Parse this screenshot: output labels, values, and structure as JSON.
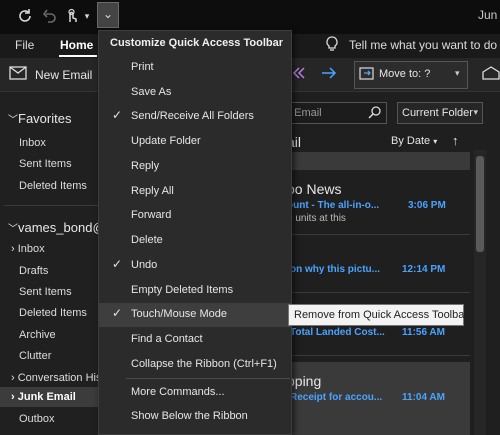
{
  "titlebar": {
    "title": "Jun",
    "qat_icons": [
      "sync-icon",
      "undo-icon",
      "touch-mode-icon",
      "dropdown-chevron-icon"
    ],
    "customize_glyph": "⌄"
  },
  "tabs": [
    {
      "label": "File"
    },
    {
      "label": "Home"
    }
  ],
  "tell_me": {
    "text": "Tell me what you want to do"
  },
  "ribbon": {
    "new_email": "New Email",
    "move_to": "Move to: ?"
  },
  "nav": {
    "favorites": "Favorites",
    "fav_items": [
      "Inbox",
      "Sent Items",
      "Deleted Items"
    ],
    "account": "vames_bond@",
    "items": [
      "Inbox",
      "Drafts",
      "Sent Items",
      "Deleted Items",
      "Archive",
      "Clutter",
      "Conversation His",
      "Junk Email",
      "Outbox"
    ],
    "selected": "Junk Email"
  },
  "list": {
    "search_placeholder": "t Email",
    "folder_scope": "Current Folder",
    "header": "ail",
    "sort": "By Date",
    "mails": [
      {
        "sender": "oo News",
        "subject": "ount - The all-in-o...",
        "time": "3:06 PM",
        "preview": "0 units at this"
      },
      {
        "sender": "",
        "subject": "on why this pictu...",
        "time": "12:14 PM",
        "preview": ""
      },
      {
        "sender": "",
        "subject": "Total Landed Cost...",
        "time": "11:56 AM",
        "preview": ""
      },
      {
        "sender": "pping",
        "subject": "Receipt for accou...",
        "time": "11:04 AM",
        "preview": ""
      }
    ]
  },
  "menu": {
    "title": "Customize Quick Access Toolbar",
    "items": [
      {
        "label": "Print",
        "checked": false
      },
      {
        "label": "Save As",
        "checked": false
      },
      {
        "label": "Send/Receive All Folders",
        "checked": true
      },
      {
        "label": "Update Folder",
        "checked": false
      },
      {
        "label": "Reply",
        "checked": false
      },
      {
        "label": "Reply All",
        "checked": false
      },
      {
        "label": "Forward",
        "checked": false
      },
      {
        "label": "Delete",
        "checked": false
      },
      {
        "label": "Undo",
        "checked": true
      },
      {
        "label": "Empty Deleted Items",
        "checked": false
      },
      {
        "label": "Touch/Mouse Mode",
        "checked": true
      },
      {
        "label": "Find a Contact",
        "checked": false
      },
      {
        "label": "Collapse the Ribbon (Ctrl+F1)",
        "checked": false
      },
      {
        "label": "More Commands...",
        "checked": false
      },
      {
        "label": "Show Below the Ribbon",
        "checked": false
      }
    ],
    "check_glyph": "✓"
  },
  "tooltip": {
    "text": "Remove from Quick Access Toolbar"
  },
  "colors": {
    "accent": "#4aa3ff",
    "menu_bg": "#2b2b2b",
    "hover_bg": "#3e3e3e"
  }
}
